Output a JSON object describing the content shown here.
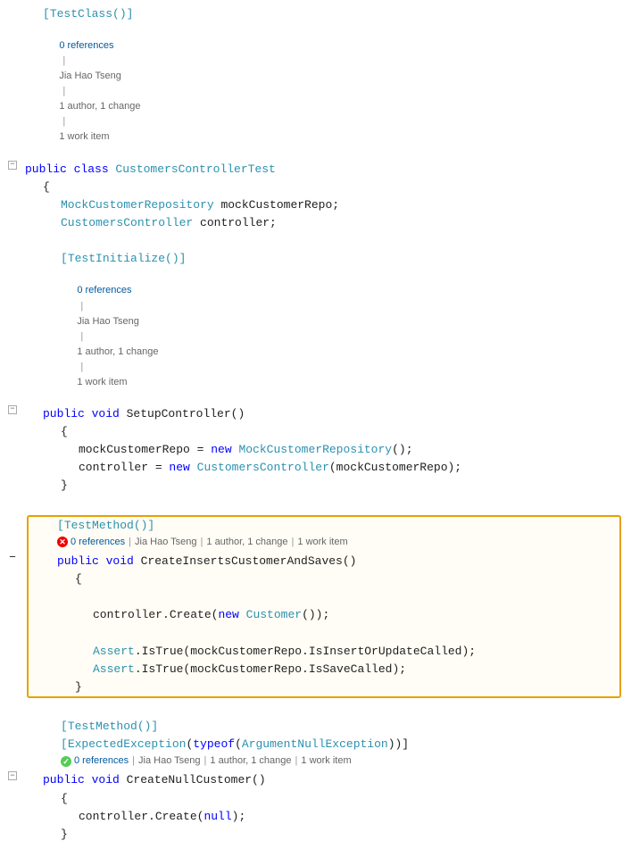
{
  "colors": {
    "keyword": "#0000ff",
    "type": "#2b91af",
    "string": "#a31515",
    "comment": "#008000",
    "text": "#1e1e1e",
    "ref": "#666",
    "link": "#005a9e",
    "highlight_border": "#e8a000",
    "error": "#cc0000",
    "ok": "#55cc55"
  },
  "sections": [
    {
      "id": "testclass-attr",
      "lines": [
        {
          "type": "attr-line",
          "indent": 1,
          "content": "[TestClass()]"
        },
        {
          "type": "ref-line",
          "indent": 1,
          "refs": "0 references",
          "author": "Jia Hao Tseng",
          "change": "1 author, 1 change",
          "workitem": "1 work item"
        },
        {
          "type": "code-line",
          "indent": 0,
          "content": "public class CustomersControllerTest"
        },
        {
          "type": "brace",
          "indent": 1,
          "content": "{"
        }
      ]
    }
  ],
  "refs": {
    "zero": "0 references",
    "author": "Jia Hao Tseng",
    "change_count": "1 author, 1 change",
    "work_item": "1 work item"
  },
  "highlighted": {
    "label": "highlighted test method block"
  }
}
